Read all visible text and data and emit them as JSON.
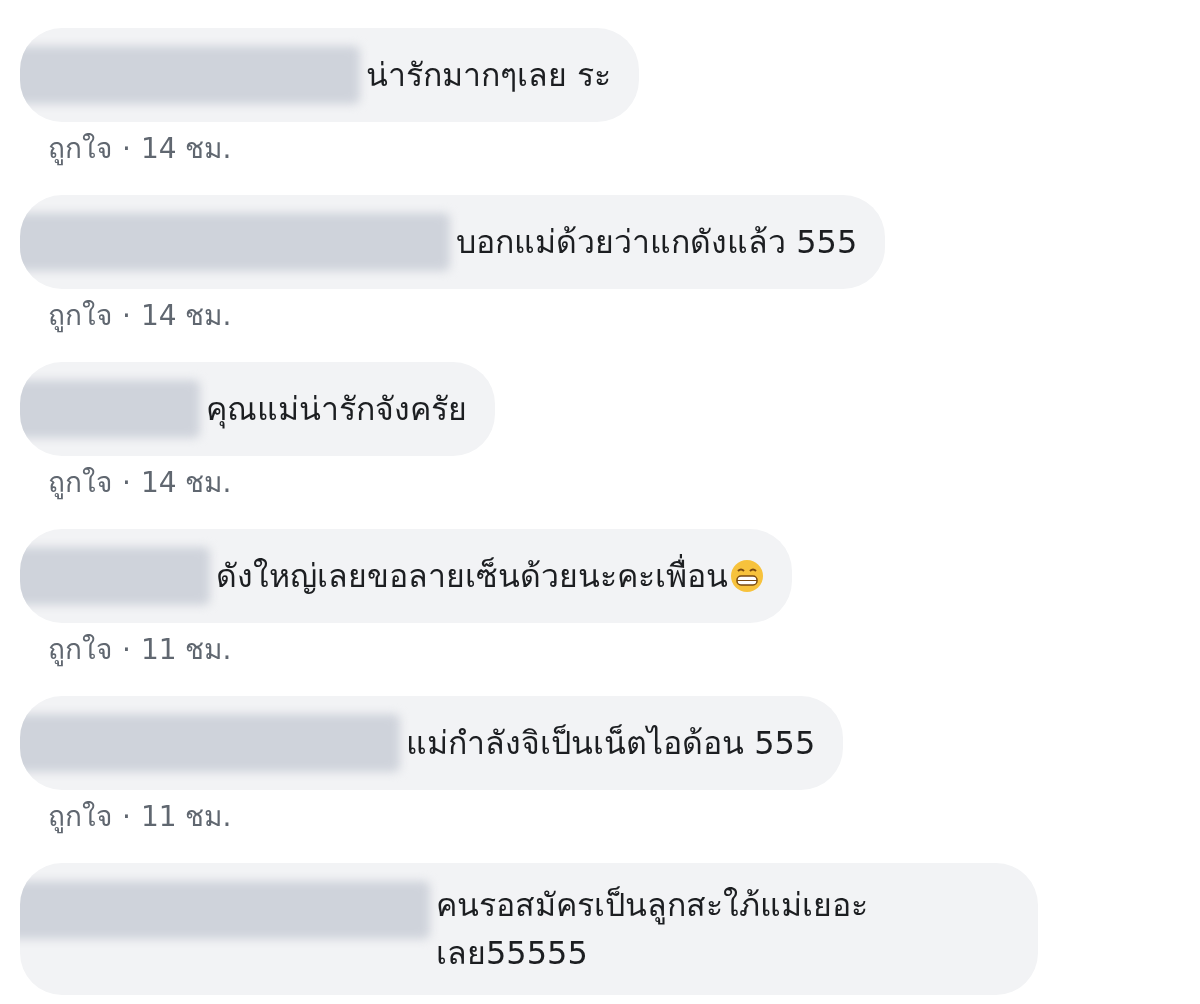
{
  "separator": "·",
  "comments": [
    {
      "text": "น่ารักมากๆเลย ระ",
      "like": "ถูกใจ",
      "time": "14 ชม."
    },
    {
      "text": "บอกแม่ด้วยว่าแกดังแล้ว 555",
      "like": "ถูกใจ",
      "time": "14 ชม."
    },
    {
      "text": "คุณแม่น่ารักจังครัย",
      "like": "ถูกใจ",
      "time": "14 ชม."
    },
    {
      "text": "ดังใหญ่เลยขอลายเซ็นด้วยนะคะเพื่อน",
      "grin_emoji": true,
      "like": "ถูกใจ",
      "time": "11 ชม."
    },
    {
      "text": "แม่กำลังจิเป็นเน็ตไอด้อน 555",
      "like": "ถูกใจ",
      "time": "11 ชม."
    },
    {
      "text": "คนรอสมัครเป็นลูกสะใภ้แม่เยอะเลย55555"
    }
  ]
}
